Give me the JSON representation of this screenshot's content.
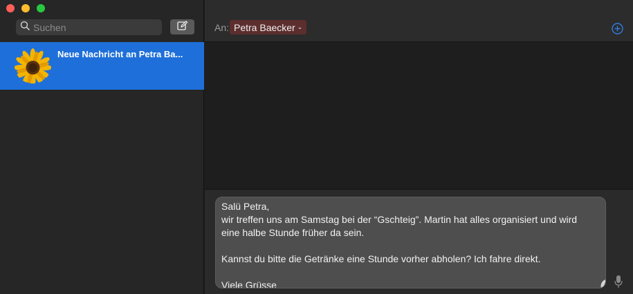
{
  "window": {
    "traffic_lights": [
      "close",
      "minimize",
      "zoom"
    ]
  },
  "sidebar": {
    "search": {
      "placeholder": "Suchen",
      "icon": "magnifier-icon"
    },
    "compose_icon": "compose-icon",
    "conversations": [
      {
        "title": "Neue Nachricht an Petra Ba...",
        "avatar": "sunflower-avatar",
        "selected": true
      }
    ]
  },
  "header": {
    "to_label": "An:",
    "recipient": "Petra Baecker",
    "add_icon": "plus-circle-icon"
  },
  "composer": {
    "message": "Salü Petra,\nwir treffen uns am Samstag bei der “Gschteig”. Martin hat alles organisiert und wird eine halbe Stunde früher da sein.\n\nKannst du bitte die Getränke eine Stunde vorher abholen? Ich fahre direkt.\n\nViele Grüsse\nKi",
    "emoji_icon": "emoji-icon",
    "mic_icon": "microphone-icon"
  },
  "colors": {
    "selection_blue": "#1e6fd9",
    "recipient_chip": "#5c2e2e",
    "accent_blue": "#2f7fe6"
  }
}
